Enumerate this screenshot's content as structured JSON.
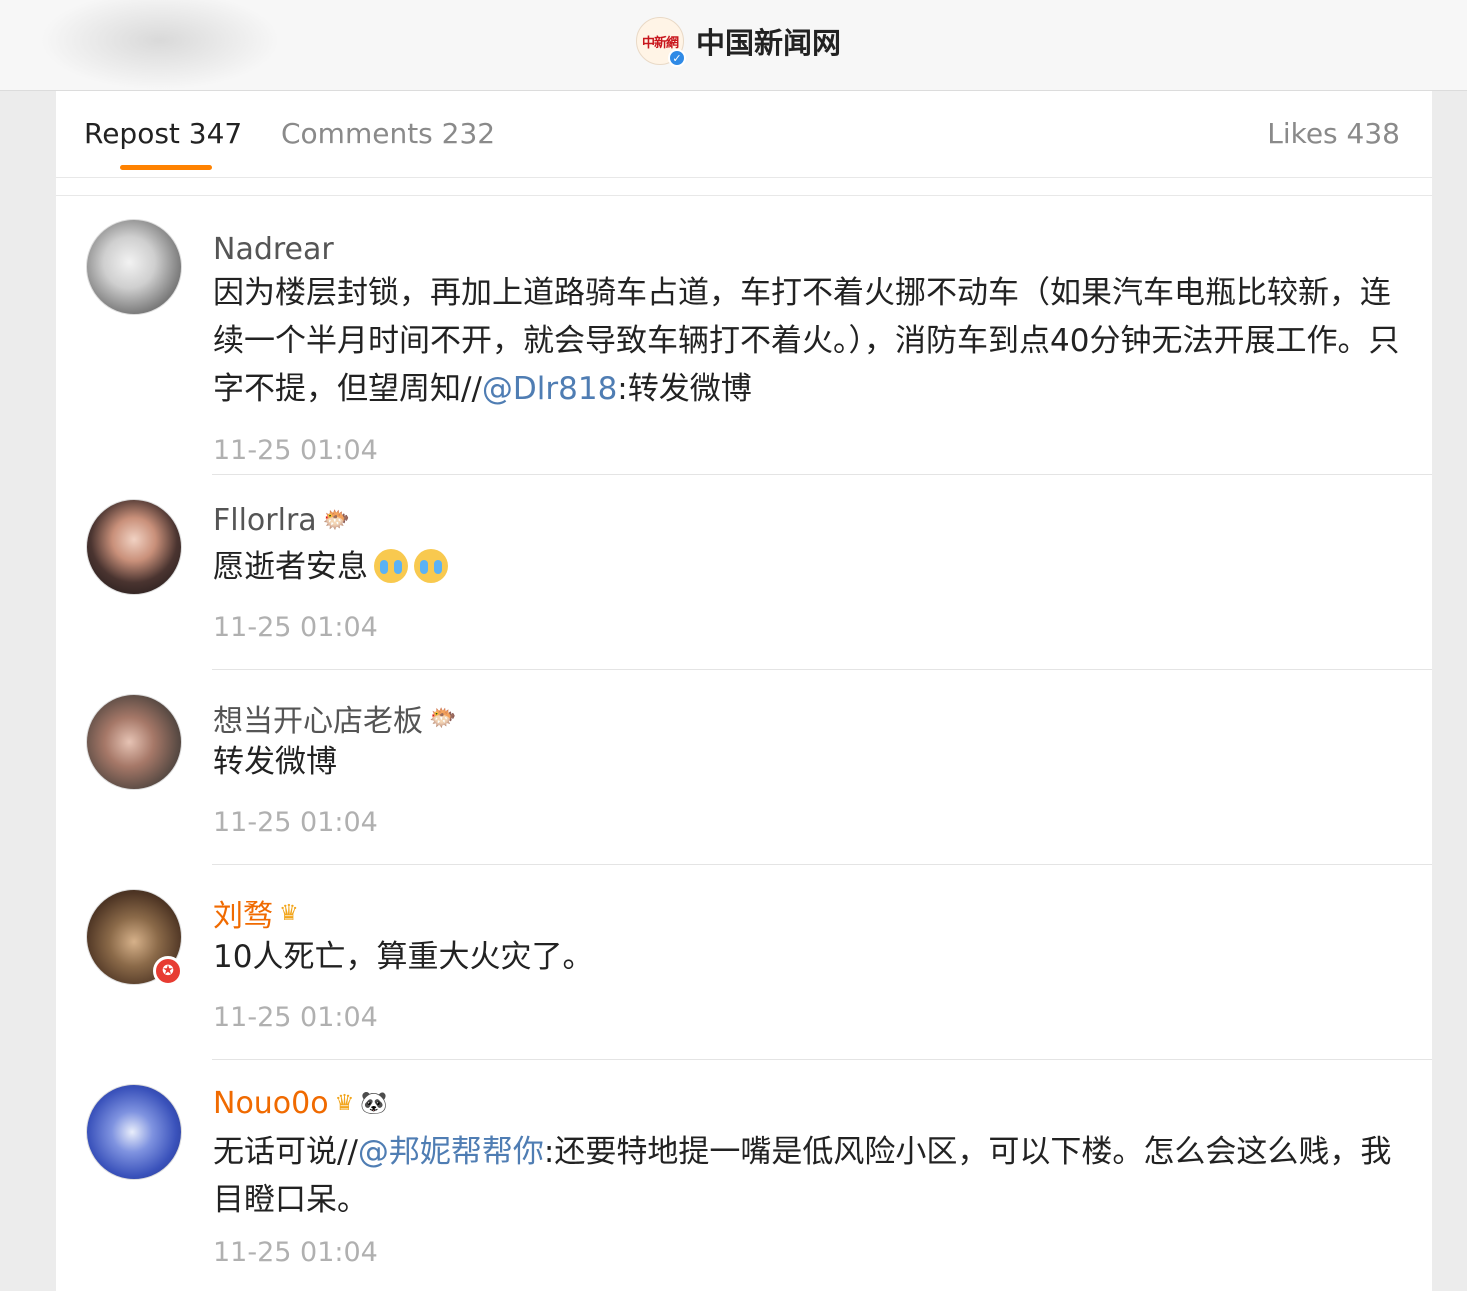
{
  "header": {
    "logo_text": "中新網",
    "account_name": "中国新闻网",
    "verified_icon": "✓"
  },
  "tabs": {
    "repost": "Repost 347",
    "comments": "Comments 232",
    "likes": "Likes 438"
  },
  "comments": [
    {
      "username": "Nadrear",
      "text_prefix": "因为楼层封锁，再加上道路骑车占道，车打不着火挪不动车（如果汽车电瓶比较新，连续一个半月时间不开，就会导致车辆打不着火。），消防车到点40分钟无法开展工作。只字不提，但望周知//",
      "mention": "@Dlr818",
      "text_suffix": ":转发微博",
      "time": "11-25 01:04"
    },
    {
      "username": "Fllorlra",
      "badge": "🐡",
      "text": "愿逝者安息",
      "emoji": [
        "crying-emoji",
        "crying-emoji"
      ],
      "time": "11-25 01:04"
    },
    {
      "username": "想当开心店老板",
      "badge": "🐡",
      "text": "转发微博",
      "time": "11-25 01:04"
    },
    {
      "username": "刘骛",
      "badge": "♛",
      "avatar_badge": "✪",
      "text": "10人死亡，算重大火灾了。",
      "time": "11-25 01:04"
    },
    {
      "username": "Nouo0o",
      "badge": "♛",
      "badge2": "🐼",
      "text_prefix": "无话可说//",
      "mention": "@邦妮帮帮你",
      "text_suffix": ":还要特地提一嘴是低风险小区，可以下楼。怎么会这么贱，我目瞪口呆。",
      "time": "11-25 01:04"
    }
  ],
  "colors": {
    "accent": "#ff8200",
    "mention": "#4f7db3",
    "vip_name": "#f06a00",
    "timestamp": "#b0b0b0"
  }
}
